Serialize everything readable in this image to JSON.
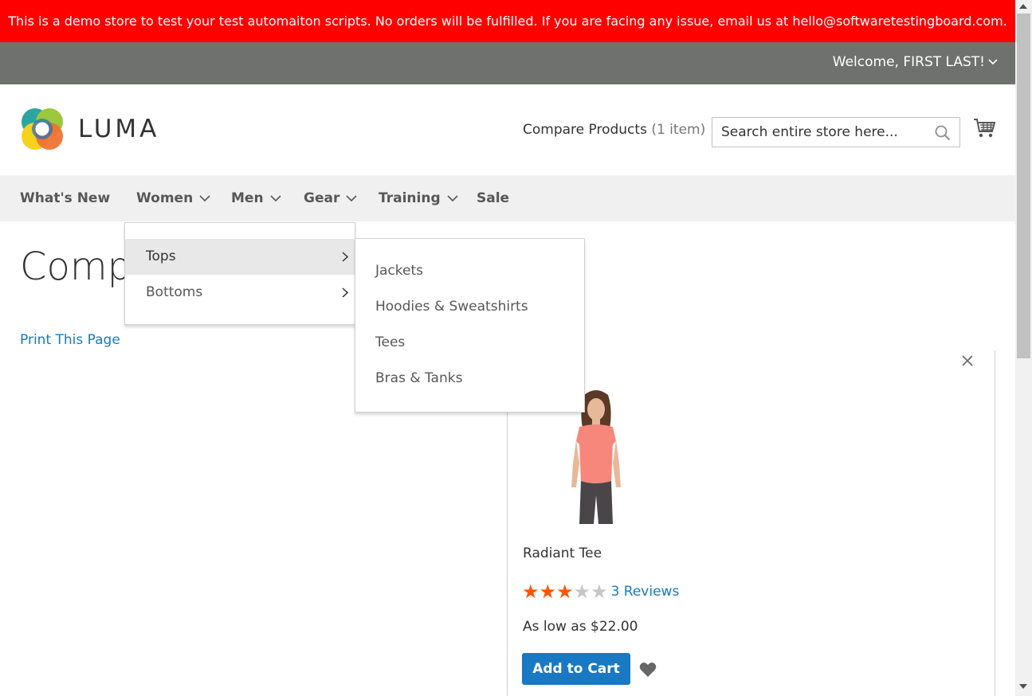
{
  "banner": {
    "text": "This is a demo store to test your test automaiton scripts. No orders will be fulfilled. If you are facing any issue, email us at hello@softwaretestingboard.com."
  },
  "top_bar": {
    "welcome": "Welcome, FIRST LAST!"
  },
  "header": {
    "logo_text": "LUMA",
    "compare_label": "Compare Products",
    "compare_count": "(1 item)",
    "search_placeholder": "Search entire store here..."
  },
  "nav": {
    "items": [
      {
        "label": "What's New",
        "has_dropdown": false
      },
      {
        "label": "Women",
        "has_dropdown": true
      },
      {
        "label": "Men",
        "has_dropdown": true
      },
      {
        "label": "Gear",
        "has_dropdown": true
      },
      {
        "label": "Training",
        "has_dropdown": true
      },
      {
        "label": "Sale",
        "has_dropdown": false
      }
    ]
  },
  "women_menu": {
    "items": [
      {
        "label": "Tops",
        "active": true
      },
      {
        "label": "Bottoms",
        "active": false
      }
    ],
    "tops_submenu": [
      "Jackets",
      "Hoodies & Sweatshirts",
      "Tees",
      "Bras & Tanks"
    ]
  },
  "page": {
    "title": "Comp",
    "print_link": "Print This Page"
  },
  "product": {
    "name": "Radiant Tee",
    "rating": 3,
    "max_rating": 5,
    "reviews": "3 Reviews",
    "price": "As low as $22.00",
    "add_to_cart": "Add to Cart"
  },
  "colors": {
    "banner": "#ff0000",
    "top_bar": "#6e716e",
    "link": "#1979c3",
    "star": "#ff5501",
    "button": "#1979c3"
  },
  "icons": [
    "chevron-down-icon",
    "luma-logo-icon",
    "search-icon",
    "cart-icon",
    "chevron-right-icon",
    "close-icon",
    "star-icon",
    "heart-icon"
  ]
}
